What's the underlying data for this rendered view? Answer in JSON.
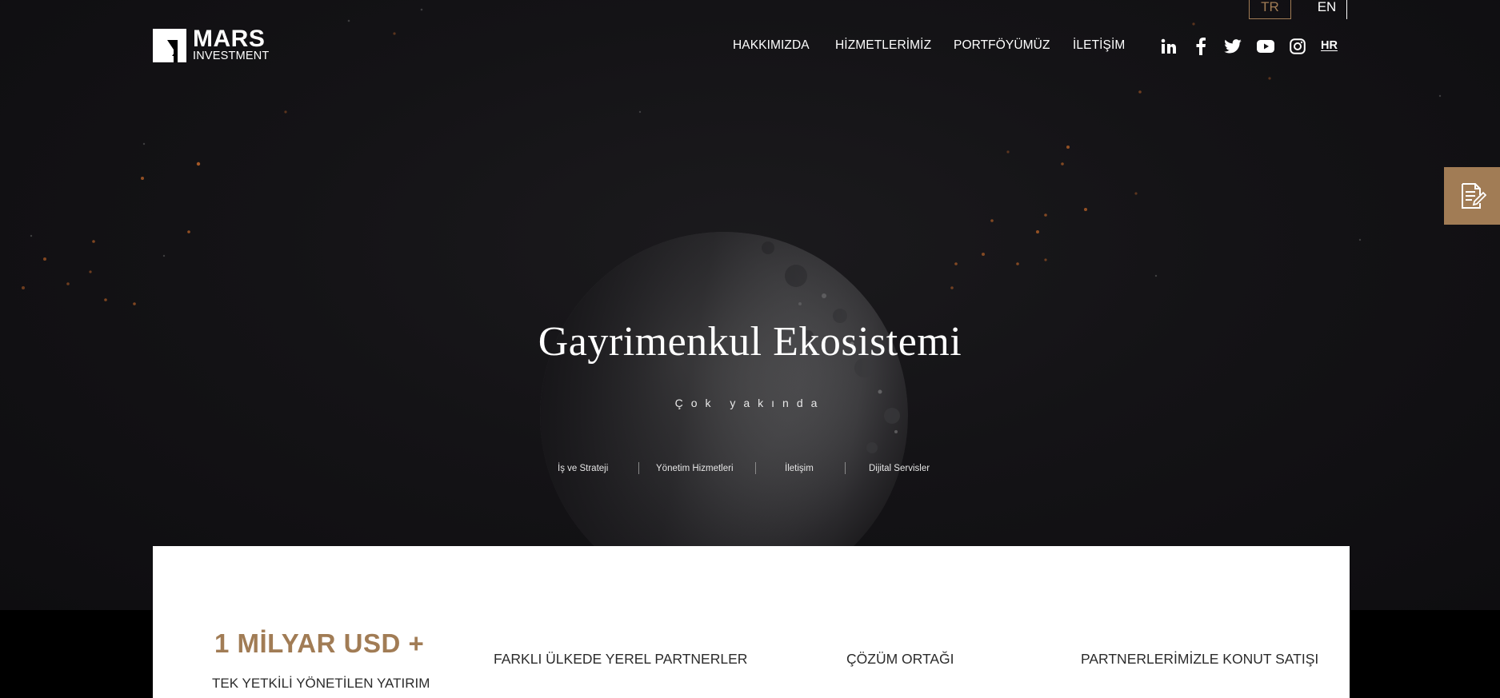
{
  "language": {
    "active": "TR",
    "other": "EN"
  },
  "logo": {
    "word": "MARS",
    "sub": "INVESTMENT"
  },
  "nav": {
    "items": [
      "HAKKIMIZDA",
      "HİZMETLERİMİZ",
      "PORTFÖYÜMÜZ",
      "İLETİŞİM"
    ]
  },
  "social": {
    "icons": [
      "linkedin-icon",
      "facebook-icon",
      "twitter-icon",
      "youtube-icon",
      "instagram-icon"
    ],
    "hr_label": "HR"
  },
  "side_tab": {
    "icon": "document-edit-icon"
  },
  "hero": {
    "title": "Gayrimenkul Ekosistemi",
    "subtitle": "Çok yakında",
    "links": [
      "İş ve Strateji",
      "Yönetim Hizmetleri",
      "İletişim",
      "Dijital Servisler"
    ]
  },
  "stats": {
    "big_value": "1 MİLYAR USD +",
    "big_desc": "TEK YETKİLİ YÖNETİLEN YATIRIM",
    "items": [
      "FARKLI ÜLKEDE YEREL PARTNERLER",
      "ÇÖZÜM ORTAĞI",
      "PARTNERLERİMİZLE KONUT SATIŞI"
    ]
  },
  "colors": {
    "accent": "#a17c55",
    "hero_bg": "#141316",
    "card_bg": "#ffffff"
  }
}
